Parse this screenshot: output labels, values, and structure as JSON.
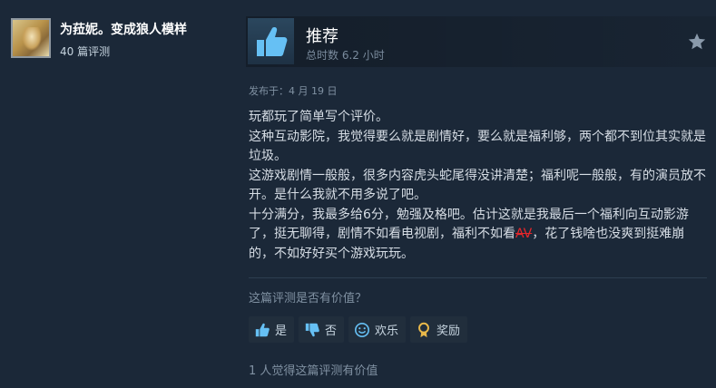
{
  "author": {
    "name": "为菈妮。变成狼人模样",
    "review_count": "40 篇评测"
  },
  "review": {
    "recommendation": "推荐",
    "hours": "总时数 6.2 小时",
    "posted": "发布于：4 月 19 日",
    "paragraphs": [
      "玩都玩了简单写个评价。",
      "这种互动影院，我觉得要么就是剧情好，要么就是福利够，两个都不到位其实就是垃圾。",
      "这游戏剧情一般般，很多内容虎头蛇尾得没讲清楚；福利呢一般般，有的演员放不开。是什么我就不用多说了吧。"
    ],
    "last_paragraph_before": "十分满分，我最多给6分，勉强及格吧。估计这就是我最后一个福利向互动影游了，挺无聊得，剧情不如看电视剧，福利不如看",
    "censored_word": "AV",
    "last_paragraph_after": "，花了钱啥也没爽到挺难崩的，不如好好买个游戏玩玩。"
  },
  "feedback": {
    "question": "这篇评测是否有价值？",
    "buttons": {
      "yes": "是",
      "no": "否",
      "funny": "欢乐",
      "award": "奖励"
    },
    "helpful_count": "1 人觉得这篇评测有价值"
  },
  "icons": {
    "recommend": "thumbs-up-icon",
    "favorite": "star-icon",
    "yes": "thumbs-up-icon",
    "no": "thumbs-down-icon",
    "funny": "smiley-icon",
    "award": "award-ribbon-icon"
  },
  "colors": {
    "background": "#1b2838",
    "thumb_blue": "#66c0f4",
    "award_gold": "#e8b84a",
    "censor_red": "#e6262a"
  }
}
